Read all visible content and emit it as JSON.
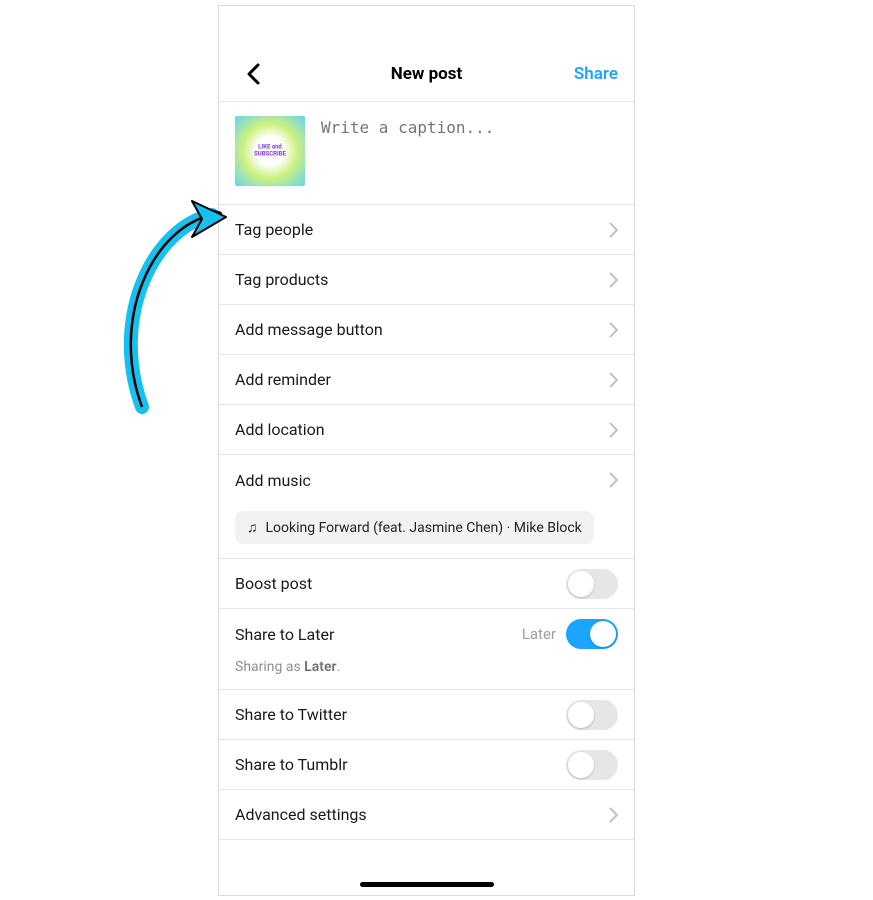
{
  "header": {
    "title": "New post",
    "share_label": "Share"
  },
  "caption": {
    "placeholder": "Write a caption...",
    "thumb_text": "LIKE and\nSUBSCRIBE"
  },
  "rows": {
    "tag_people": "Tag people",
    "tag_products": "Tag products",
    "add_message_button": "Add message button",
    "add_reminder": "Add reminder",
    "add_location": "Add location",
    "add_music": "Add music",
    "boost_post": "Boost post",
    "share_to_later": "Share to Later",
    "share_to_later_sublabel": "Later",
    "share_to_twitter": "Share to Twitter",
    "share_to_tumblr": "Share to Tumblr",
    "advanced_settings": "Advanced settings"
  },
  "music": {
    "track": "Looking Forward (feat. Jasmine Chen) · Mike Block"
  },
  "share_status": {
    "prefix": "Sharing as ",
    "target": "Later",
    "suffix": "."
  },
  "toggles": {
    "boost_post": false,
    "share_to_later": true,
    "share_to_twitter": false,
    "share_to_tumblr": false
  },
  "colors": {
    "accent": "#1ba5ff",
    "annotation_arrow": "#16c1ef"
  }
}
